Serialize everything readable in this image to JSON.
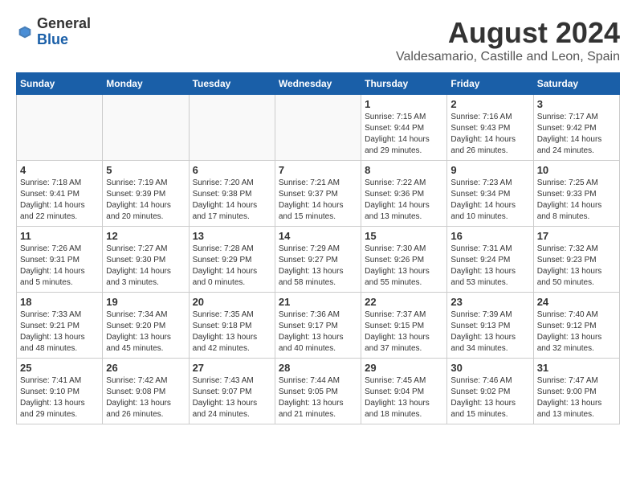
{
  "header": {
    "logo_general": "General",
    "logo_blue": "Blue",
    "main_title": "August 2024",
    "subtitle": "Valdesamario, Castille and Leon, Spain"
  },
  "days_of_week": [
    "Sunday",
    "Monday",
    "Tuesday",
    "Wednesday",
    "Thursday",
    "Friday",
    "Saturday"
  ],
  "weeks": [
    [
      {
        "day": "",
        "info": ""
      },
      {
        "day": "",
        "info": ""
      },
      {
        "day": "",
        "info": ""
      },
      {
        "day": "",
        "info": ""
      },
      {
        "day": "1",
        "info": "Sunrise: 7:15 AM\nSunset: 9:44 PM\nDaylight: 14 hours\nand 29 minutes."
      },
      {
        "day": "2",
        "info": "Sunrise: 7:16 AM\nSunset: 9:43 PM\nDaylight: 14 hours\nand 26 minutes."
      },
      {
        "day": "3",
        "info": "Sunrise: 7:17 AM\nSunset: 9:42 PM\nDaylight: 14 hours\nand 24 minutes."
      }
    ],
    [
      {
        "day": "4",
        "info": "Sunrise: 7:18 AM\nSunset: 9:41 PM\nDaylight: 14 hours\nand 22 minutes."
      },
      {
        "day": "5",
        "info": "Sunrise: 7:19 AM\nSunset: 9:39 PM\nDaylight: 14 hours\nand 20 minutes."
      },
      {
        "day": "6",
        "info": "Sunrise: 7:20 AM\nSunset: 9:38 PM\nDaylight: 14 hours\nand 17 minutes."
      },
      {
        "day": "7",
        "info": "Sunrise: 7:21 AM\nSunset: 9:37 PM\nDaylight: 14 hours\nand 15 minutes."
      },
      {
        "day": "8",
        "info": "Sunrise: 7:22 AM\nSunset: 9:36 PM\nDaylight: 14 hours\nand 13 minutes."
      },
      {
        "day": "9",
        "info": "Sunrise: 7:23 AM\nSunset: 9:34 PM\nDaylight: 14 hours\nand 10 minutes."
      },
      {
        "day": "10",
        "info": "Sunrise: 7:25 AM\nSunset: 9:33 PM\nDaylight: 14 hours\nand 8 minutes."
      }
    ],
    [
      {
        "day": "11",
        "info": "Sunrise: 7:26 AM\nSunset: 9:31 PM\nDaylight: 14 hours\nand 5 minutes."
      },
      {
        "day": "12",
        "info": "Sunrise: 7:27 AM\nSunset: 9:30 PM\nDaylight: 14 hours\nand 3 minutes."
      },
      {
        "day": "13",
        "info": "Sunrise: 7:28 AM\nSunset: 9:29 PM\nDaylight: 14 hours\nand 0 minutes."
      },
      {
        "day": "14",
        "info": "Sunrise: 7:29 AM\nSunset: 9:27 PM\nDaylight: 13 hours\nand 58 minutes."
      },
      {
        "day": "15",
        "info": "Sunrise: 7:30 AM\nSunset: 9:26 PM\nDaylight: 13 hours\nand 55 minutes."
      },
      {
        "day": "16",
        "info": "Sunrise: 7:31 AM\nSunset: 9:24 PM\nDaylight: 13 hours\nand 53 minutes."
      },
      {
        "day": "17",
        "info": "Sunrise: 7:32 AM\nSunset: 9:23 PM\nDaylight: 13 hours\nand 50 minutes."
      }
    ],
    [
      {
        "day": "18",
        "info": "Sunrise: 7:33 AM\nSunset: 9:21 PM\nDaylight: 13 hours\nand 48 minutes."
      },
      {
        "day": "19",
        "info": "Sunrise: 7:34 AM\nSunset: 9:20 PM\nDaylight: 13 hours\nand 45 minutes."
      },
      {
        "day": "20",
        "info": "Sunrise: 7:35 AM\nSunset: 9:18 PM\nDaylight: 13 hours\nand 42 minutes."
      },
      {
        "day": "21",
        "info": "Sunrise: 7:36 AM\nSunset: 9:17 PM\nDaylight: 13 hours\nand 40 minutes."
      },
      {
        "day": "22",
        "info": "Sunrise: 7:37 AM\nSunset: 9:15 PM\nDaylight: 13 hours\nand 37 minutes."
      },
      {
        "day": "23",
        "info": "Sunrise: 7:39 AM\nSunset: 9:13 PM\nDaylight: 13 hours\nand 34 minutes."
      },
      {
        "day": "24",
        "info": "Sunrise: 7:40 AM\nSunset: 9:12 PM\nDaylight: 13 hours\nand 32 minutes."
      }
    ],
    [
      {
        "day": "25",
        "info": "Sunrise: 7:41 AM\nSunset: 9:10 PM\nDaylight: 13 hours\nand 29 minutes."
      },
      {
        "day": "26",
        "info": "Sunrise: 7:42 AM\nSunset: 9:08 PM\nDaylight: 13 hours\nand 26 minutes."
      },
      {
        "day": "27",
        "info": "Sunrise: 7:43 AM\nSunset: 9:07 PM\nDaylight: 13 hours\nand 24 minutes."
      },
      {
        "day": "28",
        "info": "Sunrise: 7:44 AM\nSunset: 9:05 PM\nDaylight: 13 hours\nand 21 minutes."
      },
      {
        "day": "29",
        "info": "Sunrise: 7:45 AM\nSunset: 9:04 PM\nDaylight: 13 hours\nand 18 minutes."
      },
      {
        "day": "30",
        "info": "Sunrise: 7:46 AM\nSunset: 9:02 PM\nDaylight: 13 hours\nand 15 minutes."
      },
      {
        "day": "31",
        "info": "Sunrise: 7:47 AM\nSunset: 9:00 PM\nDaylight: 13 hours\nand 13 minutes."
      }
    ]
  ]
}
